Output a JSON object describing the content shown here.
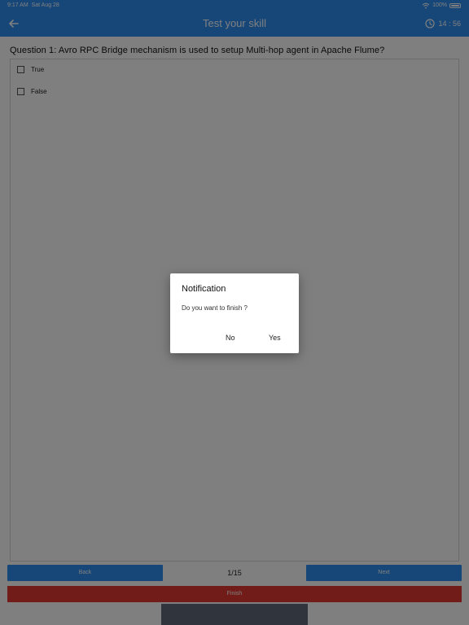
{
  "status_bar": {
    "time": "9:17 AM",
    "date": "Sat Aug 28",
    "battery": "100%"
  },
  "header": {
    "title": "Test your skill",
    "timer": "14 : 56"
  },
  "question": {
    "text": "Question 1: Avro RPC Bridge mechanism is used to setup Multi-hop agent in Apache Flume?",
    "options": [
      {
        "label": "True"
      },
      {
        "label": "False"
      }
    ]
  },
  "nav": {
    "back_label": "Back",
    "page": "1/15",
    "next_label": "Next",
    "finish_label": "Finish"
  },
  "dialog": {
    "title": "Notification",
    "message": "Do you want to finish ?",
    "no_label": "No",
    "yes_label": "Yes"
  },
  "colors": {
    "accent": "#2f8ff0",
    "finish": "#e53935",
    "overlay": "rgba(0,0,0,0.5)"
  }
}
